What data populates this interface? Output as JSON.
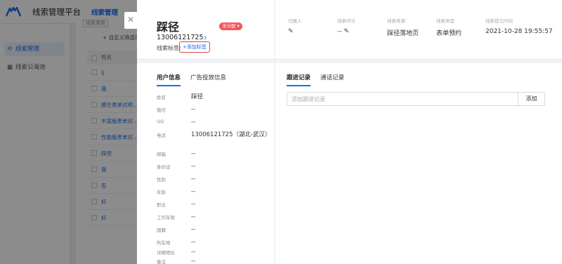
{
  "app": {
    "title": "线索管理平台",
    "nav_active": "线索管理",
    "brand_color": "#1a6cf0"
  },
  "sidebar": {
    "items": [
      {
        "label": "线索管理",
        "icon": "link-icon",
        "active": true
      },
      {
        "label": "线索公海池",
        "icon": "grid-icon",
        "active": false
      }
    ]
  },
  "list": {
    "filter_pill": "线索类型",
    "custom_filter": "+ 自定义筛选项",
    "column_header": "姓名",
    "rows": [
      "lj",
      "我",
      "膜生表单对吧...",
      "丰富版表单对...",
      "性能版表单对...",
      "踩径",
      "我",
      "否",
      "好",
      "好"
    ]
  },
  "drawer": {
    "close_icon": "close-icon",
    "lead_name": "踩径",
    "status_badge": "未分配",
    "status_color": "#f4565a",
    "phone": "13006121725",
    "tag_label": "线索标签:",
    "add_tag": "+添加标签",
    "meta": [
      {
        "label": "归属人",
        "value": "",
        "icon": "edit-icon"
      },
      {
        "label": "线索评分",
        "value": "--",
        "icon": "edit-icon"
      },
      {
        "label": "线索来源",
        "value": "踩径落地页"
      },
      {
        "label": "线索类型",
        "value": "表单预约"
      },
      {
        "label": "线索提交时间",
        "value": "2021-10-28 19:55:57"
      }
    ],
    "left_tabs": [
      "用户信息",
      "广告投放信息"
    ],
    "user_info": [
      {
        "label": "姓名",
        "value": "踩径"
      },
      {
        "label": "微信",
        "value": "--"
      },
      {
        "label": "QQ",
        "value": "--"
      },
      {
        "label": "电话",
        "value": "13006121725（湖北-武汉）"
      },
      {
        "label": "邮箱",
        "value": "--"
      },
      {
        "label": "身份证",
        "value": "--"
      },
      {
        "label": "性别",
        "value": "--"
      },
      {
        "label": "年龄",
        "value": "--"
      },
      {
        "label": "职业",
        "value": "--"
      },
      {
        "label": "工作年限",
        "value": "--"
      },
      {
        "label": "国籍",
        "value": "--"
      },
      {
        "label": "所在地",
        "value": "--"
      },
      {
        "label": "详细地址",
        "value": "--"
      },
      {
        "label": "备注",
        "value": "--"
      }
    ],
    "right_tabs": [
      "跟进记录",
      "通话记录"
    ],
    "follow_placeholder": "添加跟进记录",
    "follow_add_button": "添加"
  }
}
